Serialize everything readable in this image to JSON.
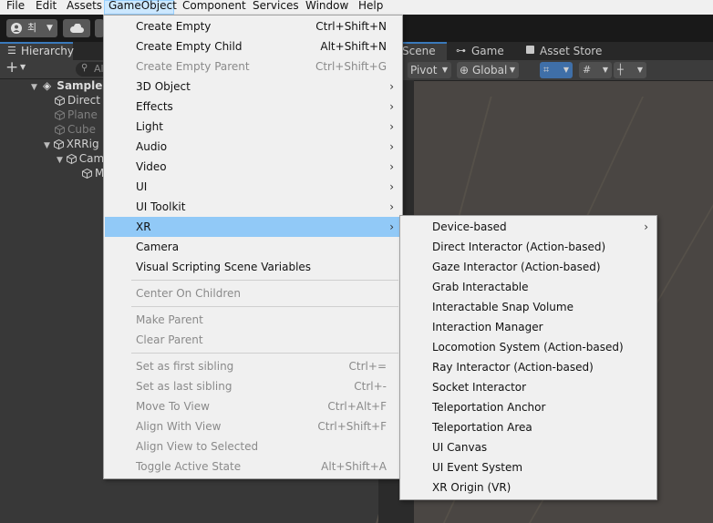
{
  "menubar": {
    "items": [
      "File",
      "Edit",
      "Assets",
      "GameObject",
      "Component",
      "Services",
      "Window",
      "Help"
    ],
    "active": "GameObject"
  },
  "toolbar": {
    "account_label": "최",
    "account_icon": "user-icon",
    "cloud_icon": "cloud-icon"
  },
  "hierarchy": {
    "tab_label": "Hierarchy",
    "search_placeholder": "Al",
    "tree": [
      {
        "label": "SampleS",
        "style": "bold"
      },
      {
        "label": "Direct",
        "style": "normal"
      },
      {
        "label": "Plane",
        "style": "dim"
      },
      {
        "label": "Cube",
        "style": "dim"
      },
      {
        "label": "XRRig",
        "style": "normal"
      },
      {
        "label": "Cam",
        "style": "normal"
      },
      {
        "label": "M",
        "style": "normal"
      }
    ]
  },
  "scene": {
    "tabs": [
      "Scene",
      "Game",
      "Asset Store"
    ],
    "pivot_label": "Pivot",
    "global_label": "Global"
  },
  "gameobject_menu": {
    "items": [
      {
        "label": "Create Empty",
        "shortcut": "Ctrl+Shift+N",
        "disabled": false
      },
      {
        "label": "Create Empty Child",
        "shortcut": "Alt+Shift+N",
        "disabled": false
      },
      {
        "label": "Create Empty Parent",
        "shortcut": "Ctrl+Shift+G",
        "disabled": true
      },
      {
        "label": "3D Object",
        "submenu": true
      },
      {
        "label": "Effects",
        "submenu": true
      },
      {
        "label": "Light",
        "submenu": true
      },
      {
        "label": "Audio",
        "submenu": true
      },
      {
        "label": "Video",
        "submenu": true
      },
      {
        "label": "UI",
        "submenu": true
      },
      {
        "label": "UI Toolkit",
        "submenu": true
      },
      {
        "label": "XR",
        "submenu": true,
        "highlighted": true
      },
      {
        "label": "Camera"
      },
      {
        "label": "Visual Scripting Scene Variables"
      },
      {
        "label": "Center On Children",
        "disabled": true
      },
      {
        "label": "Make Parent",
        "disabled": true
      },
      {
        "label": "Clear Parent",
        "disabled": true
      },
      {
        "label": "Set as first sibling",
        "shortcut": "Ctrl+=",
        "disabled": true
      },
      {
        "label": "Set as last sibling",
        "shortcut": "Ctrl+-",
        "disabled": true
      },
      {
        "label": "Move To View",
        "shortcut": "Ctrl+Alt+F",
        "disabled": true
      },
      {
        "label": "Align With View",
        "shortcut": "Ctrl+Shift+F",
        "disabled": true
      },
      {
        "label": "Align View to Selected",
        "disabled": true
      },
      {
        "label": "Toggle Active State",
        "shortcut": "Alt+Shift+A",
        "disabled": true
      }
    ]
  },
  "xr_submenu": {
    "items": [
      {
        "label": "Device-based",
        "submenu": true
      },
      {
        "label": "Direct Interactor (Action-based)"
      },
      {
        "label": "Gaze Interactor (Action-based)"
      },
      {
        "label": "Grab Interactable"
      },
      {
        "label": "Interactable Snap Volume"
      },
      {
        "label": "Interaction Manager"
      },
      {
        "label": "Locomotion System (Action-based)"
      },
      {
        "label": "Ray Interactor (Action-based)"
      },
      {
        "label": "Socket Interactor"
      },
      {
        "label": "Teleportation Anchor"
      },
      {
        "label": "Teleportation Area"
      },
      {
        "label": "UI Canvas"
      },
      {
        "label": "UI Event System"
      },
      {
        "label": "XR Origin (VR)"
      }
    ]
  },
  "colors": {
    "menu_highlight": "#91c9f7",
    "menubar_active": "#cce8ff",
    "editor_dark": "#383838"
  }
}
